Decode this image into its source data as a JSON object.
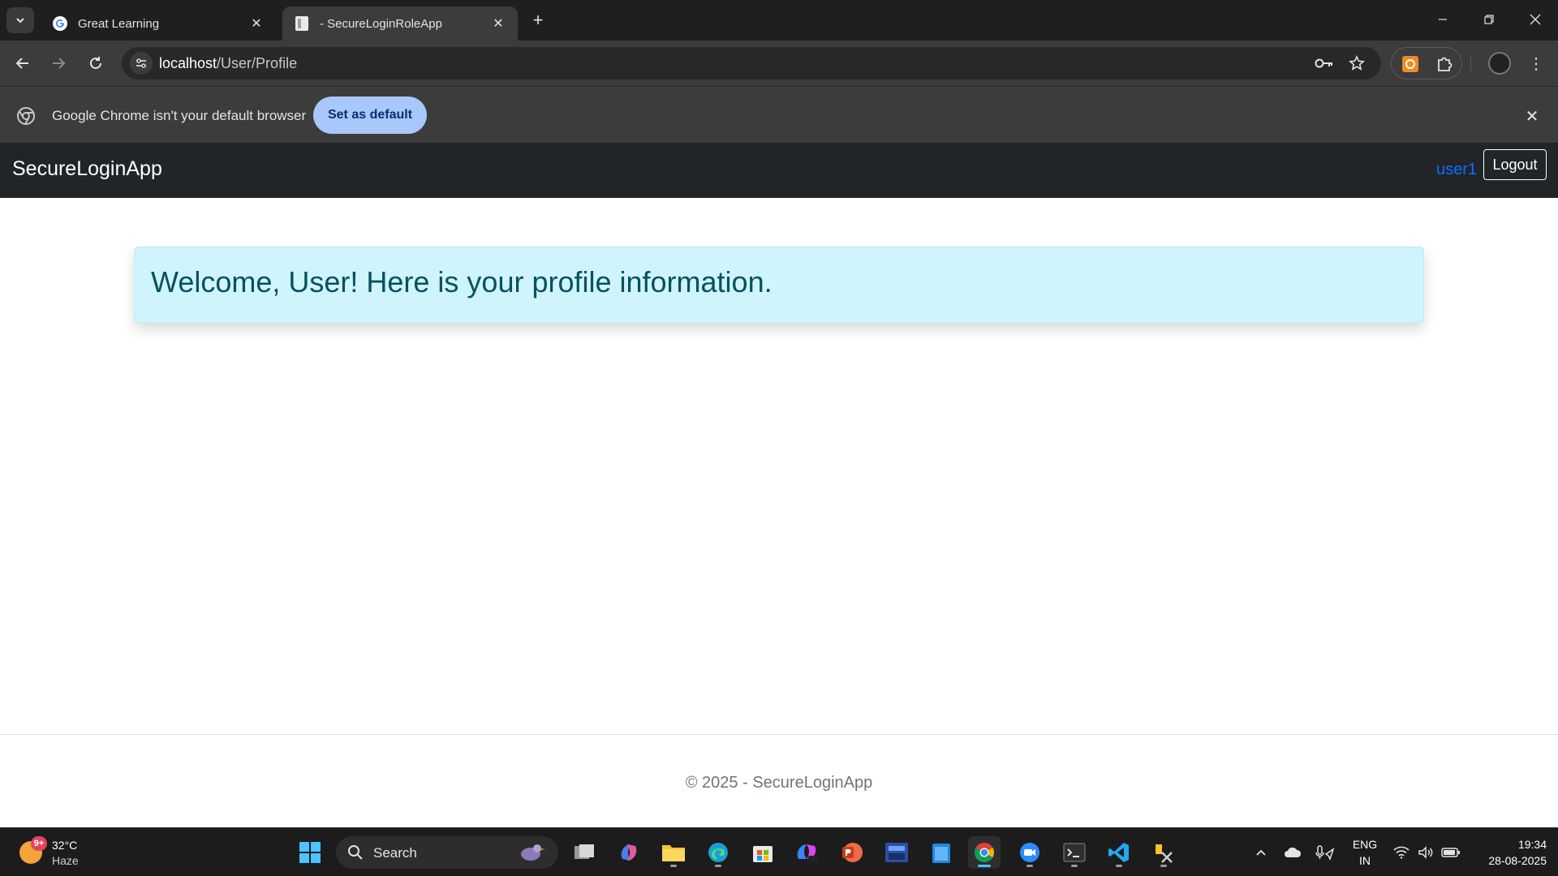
{
  "browser": {
    "tabs": [
      {
        "title": "Great Learning"
      },
      {
        "title": "- SecureLoginRoleApp"
      }
    ],
    "url_host": "localhost",
    "url_path": "/User/Profile",
    "infobar": {
      "message": "Google Chrome isn't your default browser",
      "button_label": "Set as default"
    }
  },
  "app": {
    "brand": "SecureLoginApp",
    "username": "user1",
    "logout_label": "Logout",
    "welcome_message": "Welcome, User! Here is your profile information.",
    "footer_text": "© 2025 - SecureLoginApp"
  },
  "taskbar": {
    "weather_badge": "9+",
    "temperature": "32°C",
    "condition": "Haze",
    "search_label": "Search",
    "language_line1": "ENG",
    "language_line2": "IN",
    "time": "19:34",
    "date": "28-08-2025"
  },
  "colors": {
    "chrome_dark": "#1f1f1f",
    "toolbar": "#3c3c3c",
    "navbar": "#212529",
    "link_blue": "#0d6efd",
    "alert_bg": "#cff4fc",
    "alert_text": "#055160",
    "default_button": "#a8c7fa"
  }
}
